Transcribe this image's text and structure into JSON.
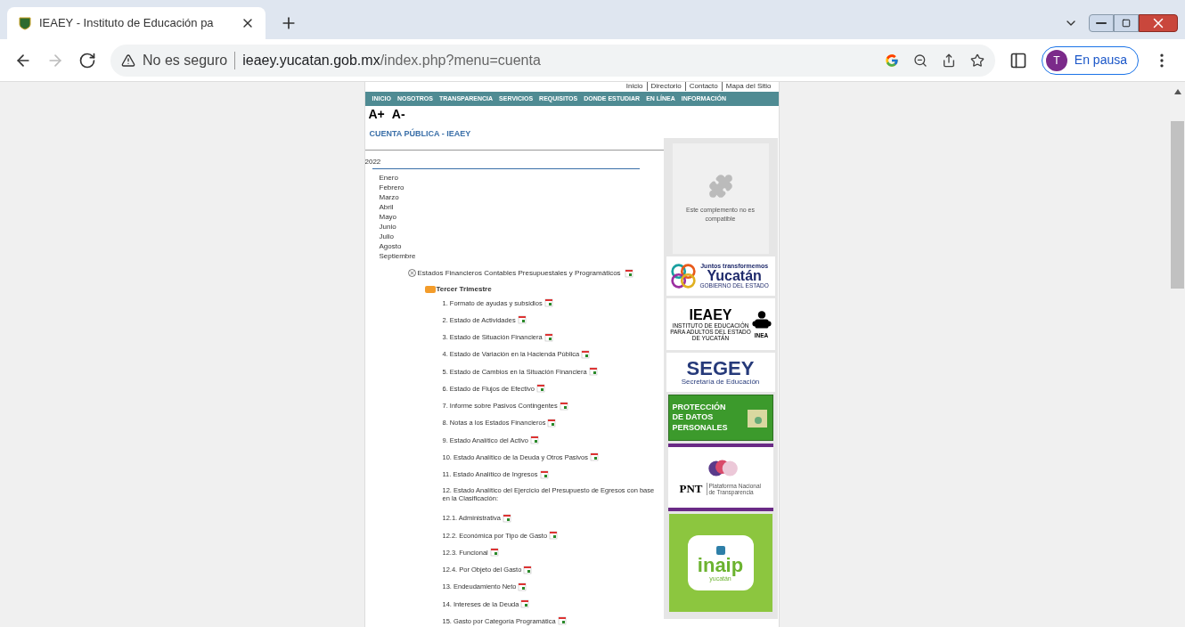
{
  "browser": {
    "tab_title": "IEAEY - Instituto de Educación pa",
    "security": "No es seguro",
    "url_host": "ieaey.yucatan.gob.mx",
    "url_path": "/index.php?menu=cuenta",
    "profile_initial": "T",
    "profile_status": "En pausa"
  },
  "top_links": [
    "Inicio",
    "Directorio",
    "Contacto",
    "Mapa del Sitio"
  ],
  "nav": [
    "INICIO",
    "NOSOTROS",
    "TRANSPARENCIA",
    "SERVICIOS",
    "REQUISITOS",
    "DONDE ESTUDIAR",
    "EN LÍNEA",
    "INFORMACIÓN"
  ],
  "font_controls": [
    "A+",
    "A-"
  ],
  "title": "CUENTA PÚBLICA - IEAEY",
  "year": "2022",
  "months": [
    "Enero",
    "Febrero",
    "Marzo",
    "Abril",
    "Mayo",
    "Junio",
    "Julio",
    "Agosto",
    "Septiembre"
  ],
  "tree": [
    {
      "title": "Estados Financieros Contables Presupuestales y Programáticos",
      "expanded": true,
      "children": [
        {
          "title": "Tercer Trimestre",
          "expanded": true,
          "items": [
            {
              "kind": "doc",
              "label": "1. Formato de ayudas y subsidios"
            },
            {
              "kind": "doc",
              "label": "2. Estado de Actividades"
            },
            {
              "kind": "doc",
              "label": "3. Estado de Situación Financiera"
            },
            {
              "kind": "doc",
              "label": "4. Estado de Variación en la Hacienda Pública"
            },
            {
              "kind": "doc",
              "label": "5. Estado de Cambios en la Situación Financiera"
            },
            {
              "kind": "doc",
              "label": "6. Estado de Flujos de Efectivo"
            },
            {
              "kind": "doc",
              "label": "7. Informe sobre Pasivos Contingentes"
            },
            {
              "kind": "doc",
              "label": "8. Notas a los Estados Financieros"
            },
            {
              "kind": "doc",
              "label": "9. Estado Analítico del Activo"
            },
            {
              "kind": "doc",
              "label": "10. Estado Analítico de la Deuda y Otros Pasivos"
            },
            {
              "kind": "doc",
              "label": "11. Estado Analítico de Ingresos"
            },
            {
              "kind": "heading",
              "label": "12. Estado Analítico del Ejercicio del Presupuesto de Egresos con base en la Clasificación:"
            },
            {
              "kind": "doc",
              "label": "12.1. Administrativa"
            },
            {
              "kind": "doc",
              "label": "12.2. Económica por Tipo de Gasto"
            },
            {
              "kind": "doc",
              "label": "12.3. Funcional"
            },
            {
              "kind": "doc",
              "label": "12.4. Por Objeto del Gasto"
            },
            {
              "kind": "doc",
              "label": "13. Endeudamiento Neto"
            },
            {
              "kind": "doc",
              "label": "14. Intereses de la Deuda"
            },
            {
              "kind": "doc",
              "label": "15. Gasto por Categoría Programática"
            }
          ]
        }
      ]
    }
  ],
  "plugin_message": "Este complemento no es compatible",
  "banners": [
    {
      "kind": "yucatan",
      "lines": [
        "Juntos transformemos",
        "Yucatán",
        "GOBIERNO DEL ESTADO"
      ]
    },
    {
      "kind": "ieaey",
      "lines": [
        "IEAEY",
        "INSTITUTO DE EDUCACIÓN PARA ADULTOS DEL ESTADO DE YUCATÁN",
        "INEA"
      ]
    },
    {
      "kind": "segey",
      "lines": [
        "SEGEY",
        "Secretaría de Educación"
      ]
    },
    {
      "kind": "datos",
      "lines": [
        "PROTECCIÓN",
        "DE DATOS",
        "PERSONALES"
      ]
    },
    {
      "kind": "pnt",
      "lines": [
        "PNT",
        "Plataforma Nacional de Transparencia"
      ]
    },
    {
      "kind": "inaip",
      "lines": [
        "inaip",
        "yucatán"
      ]
    }
  ]
}
